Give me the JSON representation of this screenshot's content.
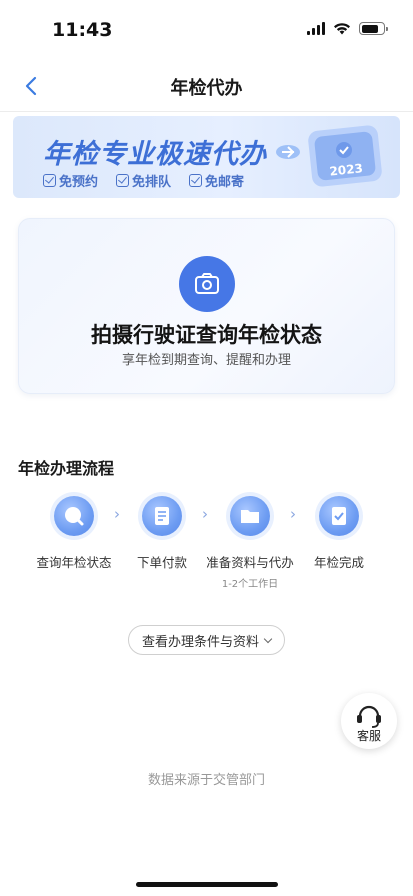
{
  "status_bar": {
    "time": "11:43"
  },
  "nav": {
    "title": "年检代办"
  },
  "banner": {
    "title": "年检专业极速代办",
    "tags": [
      "免预约",
      "免排队",
      "免邮寄"
    ],
    "badge_year": "2023"
  },
  "photo_card": {
    "title": "拍摄行驶证查询年检状态",
    "subtitle": "享年检到期查询、提醒和办理"
  },
  "process": {
    "title": "年检办理流程",
    "steps": [
      {
        "label": "查询年检状态",
        "sub": ""
      },
      {
        "label": "下单付款",
        "sub": ""
      },
      {
        "label": "准备资料与代办",
        "sub": "1-2个工作日"
      },
      {
        "label": "年检完成",
        "sub": ""
      }
    ],
    "arrow": "›"
  },
  "conditions_button": {
    "label": "查看办理条件与资料"
  },
  "support": {
    "label": "客服"
  },
  "footer": {
    "note": "数据来源于交管部门"
  },
  "colors": {
    "accent": "#4677e6",
    "banner_text": "#3d6fd6"
  }
}
